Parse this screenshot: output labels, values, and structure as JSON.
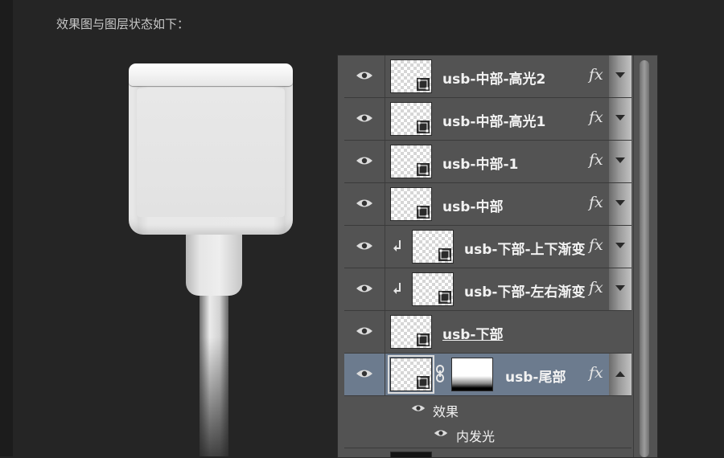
{
  "caption": "效果图与图层状态如下：",
  "colors": {
    "background": "#252525",
    "panel": "#535353",
    "selected_row": "#6c7b8e",
    "text": "#f2f2f2"
  },
  "layers": [
    {
      "name": "usb-中部-高光2",
      "fx": "fx",
      "clipped": false,
      "selected": false,
      "underlined": false
    },
    {
      "name": "usb-中部-高光1",
      "fx": "fx",
      "clipped": false,
      "selected": false,
      "underlined": false
    },
    {
      "name": "usb-中部-1",
      "fx": "fx",
      "clipped": false,
      "selected": false,
      "underlined": false
    },
    {
      "name": "usb-中部",
      "fx": "fx",
      "clipped": false,
      "selected": false,
      "underlined": false
    },
    {
      "name": "usb-下部-上下渐变",
      "fx": "fx",
      "clipped": true,
      "selected": false,
      "underlined": false
    },
    {
      "name": "usb-下部-左右渐变",
      "fx": "fx",
      "clipped": true,
      "selected": false,
      "underlined": false
    },
    {
      "name": "usb-下部",
      "fx": "",
      "clipped": false,
      "selected": false,
      "underlined": true
    },
    {
      "name": "usb-尾部",
      "fx": "fx",
      "clipped": false,
      "selected": true,
      "underlined": false,
      "has_mask": true,
      "effects_expanded": true
    }
  ],
  "effects": {
    "header": "效果",
    "items": [
      "内发光"
    ]
  }
}
